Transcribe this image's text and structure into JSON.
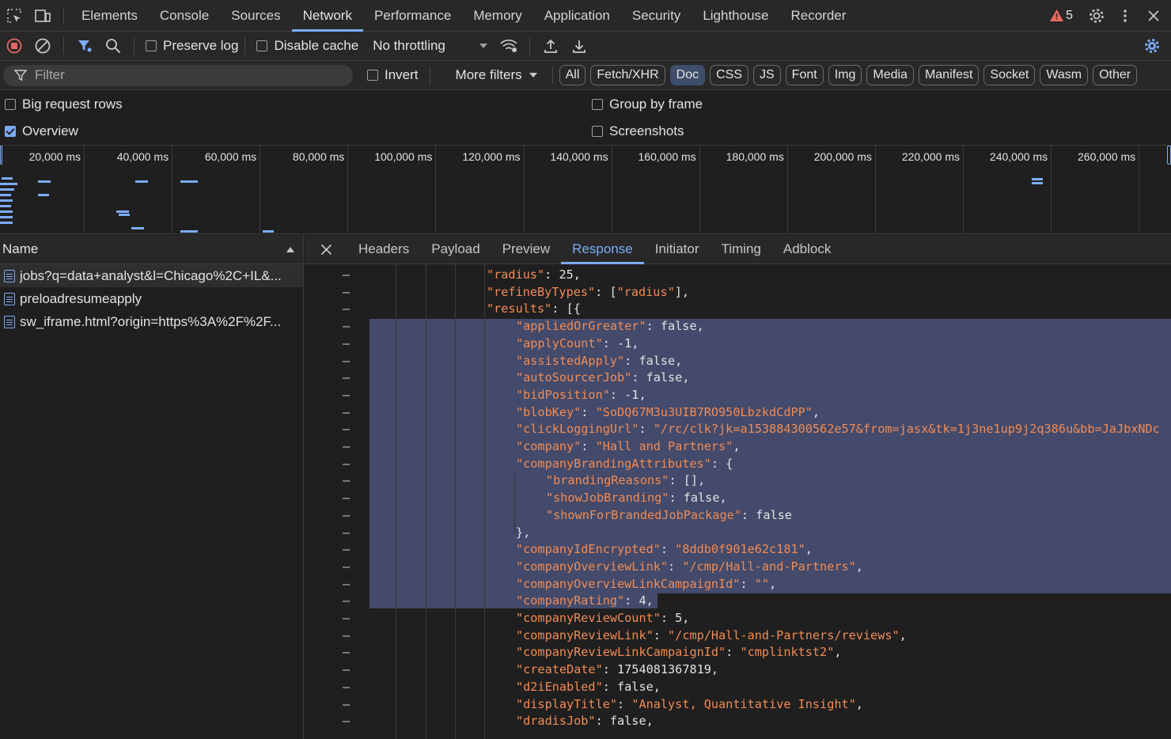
{
  "tabs": [
    "Elements",
    "Console",
    "Sources",
    "Network",
    "Performance",
    "Memory",
    "Application",
    "Security",
    "Lighthouse",
    "Recorder"
  ],
  "active_tab": "Network",
  "warning_count": "5",
  "toolbar": {
    "preserve_log": "Preserve log",
    "disable_cache": "Disable cache",
    "throttling": "No throttling"
  },
  "filter": {
    "placeholder": "Filter",
    "invert": "Invert",
    "more_filters": "More filters",
    "chips": [
      "All",
      "Fetch/XHR",
      "Doc",
      "CSS",
      "JS",
      "Font",
      "Img",
      "Media",
      "Manifest",
      "Socket",
      "Wasm",
      "Other"
    ],
    "active_chip": "Doc"
  },
  "options": {
    "big_request_rows": "Big request rows",
    "group_by_frame": "Group by frame",
    "overview": "Overview",
    "screenshots": "Screenshots"
  },
  "overview_ticks": [
    "20,000 ms",
    "40,000 ms",
    "60,000 ms",
    "80,000 ms",
    "100,000 ms",
    "120,000 ms",
    "140,000 ms",
    "160,000 ms",
    "180,000 ms",
    "200,000 ms",
    "220,000 ms",
    "240,000 ms",
    "260,000 ms"
  ],
  "requests": {
    "header": "Name",
    "items": [
      "jobs?q=data+analyst&l=Chicago%2C+IL&...",
      "preloadresumeapply",
      "sw_iframe.html?origin=https%3A%2F%2F..."
    ]
  },
  "detail_tabs": [
    "Headers",
    "Payload",
    "Preview",
    "Response",
    "Initiator",
    "Timing",
    "Adblock"
  ],
  "active_detail_tab": "Response",
  "response_lines": [
    {
      "indent": 0,
      "text": "\"radius\": 25,"
    },
    {
      "indent": 0,
      "text": "\"refineByTypes\": [\"radius\"],"
    },
    {
      "indent": 0,
      "text": "\"results\": [{"
    },
    {
      "indent": 1,
      "text": "\"appliedOrGreater\": false,"
    },
    {
      "indent": 1,
      "text": "\"applyCount\": -1,"
    },
    {
      "indent": 1,
      "text": "\"assistedApply\": false,"
    },
    {
      "indent": 1,
      "text": "\"autoSourcerJob\": false,"
    },
    {
      "indent": 1,
      "text": "\"bidPosition\": -1,"
    },
    {
      "indent": 1,
      "text": "\"blobKey\": \"SoDQ67M3u3UIB7RO950LbzkdCdPP\","
    },
    {
      "indent": 1,
      "text": "\"clickLoggingUrl\": \"/rc/clk?jk=a153884300562e57&from=jasx&tk=1j3ne1up9j2q386u&bb=JaJbxNDc"
    },
    {
      "indent": 1,
      "text": "\"company\": \"Hall and Partners\","
    },
    {
      "indent": 1,
      "text": "\"companyBrandingAttributes\": {"
    },
    {
      "indent": 2,
      "text": "\"brandingReasons\": [],"
    },
    {
      "indent": 2,
      "text": "\"showJobBranding\": false,"
    },
    {
      "indent": 2,
      "text": "\"shownForBrandedJobPackage\": false"
    },
    {
      "indent": 1,
      "text": "},"
    },
    {
      "indent": 1,
      "text": "\"companyIdEncrypted\": \"8ddb0f901e62c181\","
    },
    {
      "indent": 1,
      "text": "\"companyOverviewLink\": \"/cmp/Hall-and-Partners\","
    },
    {
      "indent": 1,
      "text": "\"companyOverviewLinkCampaignId\": \"\","
    },
    {
      "indent": 1,
      "text": "\"companyRating\": 4,"
    },
    {
      "indent": 1,
      "text": "\"companyReviewCount\": 5,"
    },
    {
      "indent": 1,
      "text": "\"companyReviewLink\": \"/cmp/Hall-and-Partners/reviews\","
    },
    {
      "indent": 1,
      "text": "\"companyReviewLinkCampaignId\": \"cmplinktst2\","
    },
    {
      "indent": 1,
      "text": "\"createDate\": 1754081367819,"
    },
    {
      "indent": 1,
      "text": "\"d2iEnabled\": false,"
    },
    {
      "indent": 1,
      "text": "\"displayTitle\": \"Analyst, Quantitative Insight\","
    },
    {
      "indent": 1,
      "text": "\"dradisJob\": false,"
    }
  ],
  "colors": {
    "accent": "#7cacf8",
    "json_key": "#f28b54",
    "selection": "#434a6b",
    "record_red": "#e46962"
  }
}
